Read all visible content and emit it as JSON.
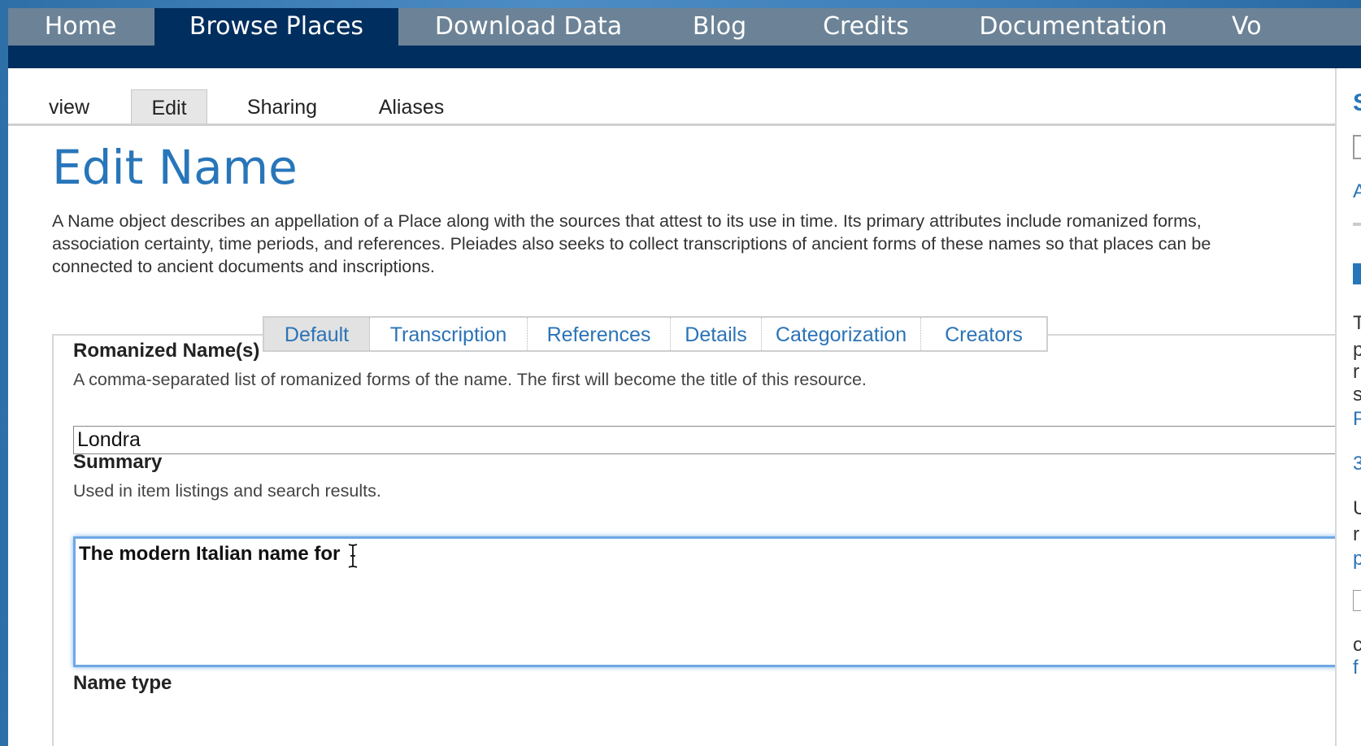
{
  "topnav": {
    "items": [
      {
        "label": "Home"
      },
      {
        "label": "Browse Places"
      },
      {
        "label": "Download Data"
      },
      {
        "label": "Blog"
      },
      {
        "label": "Credits"
      },
      {
        "label": "Documentation"
      },
      {
        "label": "Vo"
      }
    ],
    "active": "Browse Places"
  },
  "content_tabs": {
    "items": [
      {
        "label": "view"
      },
      {
        "label": "Edit"
      },
      {
        "label": "Sharing"
      },
      {
        "label": "Aliases"
      }
    ],
    "selected": "Edit"
  },
  "page": {
    "title": "Edit Name",
    "description": "A Name object describes an appellation of a Place along with the sources that attest to its use in time. Its primary attributes include romanized forms, association certainty, time periods, and references. Pleiades also seeks to collect transcriptions of ancient forms of these names so that places can be connected to ancient documents and inscriptions."
  },
  "form_tabs": {
    "items": [
      {
        "label": "Default"
      },
      {
        "label": "Transcription"
      },
      {
        "label": "References"
      },
      {
        "label": "Details"
      },
      {
        "label": "Categorization"
      },
      {
        "label": "Creators"
      }
    ],
    "selected": "Default"
  },
  "form": {
    "romanized": {
      "label": "Romanized Name(s)",
      "help": "A comma-separated list of romanized forms of the name. The first will become the title of this resource.",
      "value": "Londra"
    },
    "summary": {
      "label": "Summary",
      "help": "Used in item listings and search results.",
      "value": "The modern Italian name for"
    },
    "name_type": {
      "label": "Name type"
    }
  },
  "sidebar": {
    "fragments": [
      "S",
      "A",
      "T",
      "p",
      "r",
      "s",
      "P",
      "3",
      "U",
      "r",
      "p",
      "c",
      "f"
    ]
  },
  "colors": {
    "nav_bg": "#6c8397",
    "nav_active": "#002e5f",
    "link_blue": "#2b73b6",
    "title_blue": "#2876ba",
    "focus_ring": "#6fa8e4"
  }
}
